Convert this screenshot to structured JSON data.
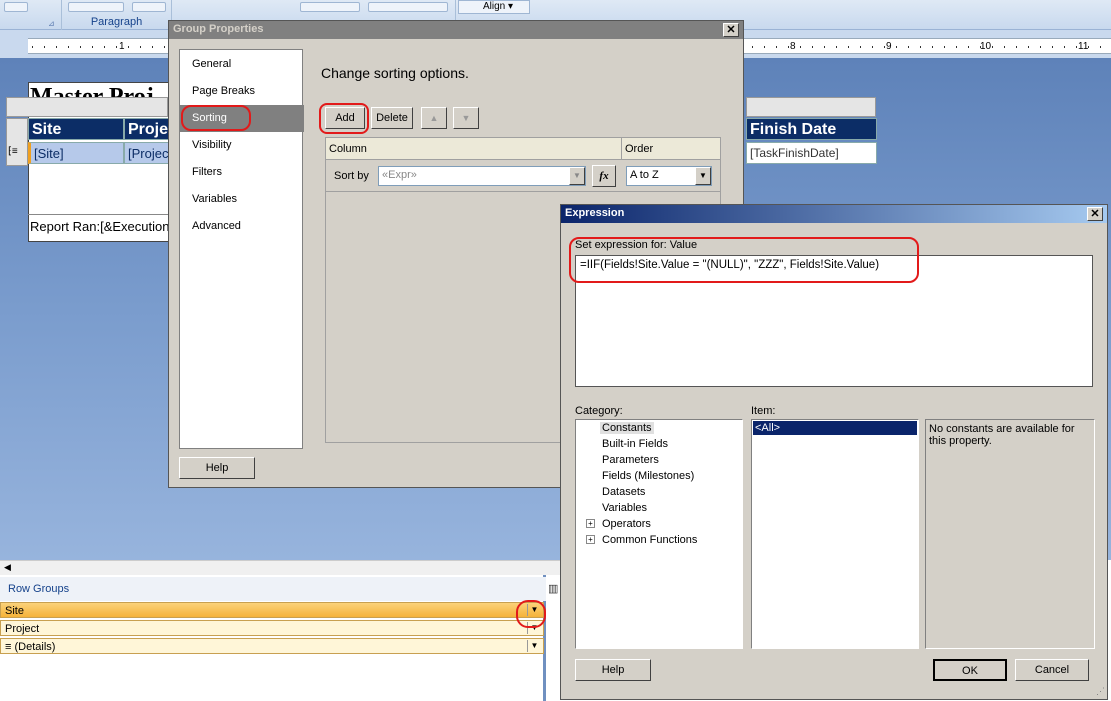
{
  "ribbon": {
    "paragraph_label": "Paragraph",
    "align_label": "Align"
  },
  "ruler": {
    "numbers": [
      "1",
      "8",
      "9",
      "10",
      "11"
    ]
  },
  "report": {
    "title": "Master Proj",
    "header_site": "Site",
    "header_project": "Projec",
    "header_finish": "Finish Date",
    "cell_site": "[Site]",
    "cell_project": "[Projec",
    "cell_finish": "[TaskFinishDate]",
    "footer": "Report Ran:[&Execution"
  },
  "row_groups": {
    "title": "Row Groups",
    "rows": [
      "Site",
      "Project",
      "≡ (Details)"
    ]
  },
  "group_properties": {
    "title": "Group Properties",
    "nav": [
      "General",
      "Page Breaks",
      "Sorting",
      "Visibility",
      "Filters",
      "Variables",
      "Advanced"
    ],
    "heading": "Change sorting options.",
    "add_label": "Add",
    "delete_label": "Delete",
    "col_column": "Column",
    "col_order": "Order",
    "sort_by_label": "Sort by",
    "sort_by_value": "«Expr»",
    "order_value": "A to Z",
    "fx_label": "fx",
    "help_label": "Help"
  },
  "expression": {
    "title": "Expression",
    "set_label": "Set expression for: Value",
    "expression_text": "=IIF(Fields!Site.Value = \"(NULL)\", \"ZZZ\", Fields!Site.Value)",
    "category_label": "Category:",
    "item_label": "Item:",
    "categories": [
      "Constants",
      "Built-in Fields",
      "Parameters",
      "Fields (Milestones)",
      "Datasets",
      "Variables",
      "Operators",
      "Common Functions"
    ],
    "items": [
      "<All>"
    ],
    "description": "No constants are available for this property.",
    "help_label": "Help",
    "ok_label": "OK",
    "cancel_label": "Cancel"
  },
  "colors": {
    "highlight_red": "#e21a1a",
    "title_blue": "#0a246a",
    "header_navy": "#0c2d66"
  }
}
